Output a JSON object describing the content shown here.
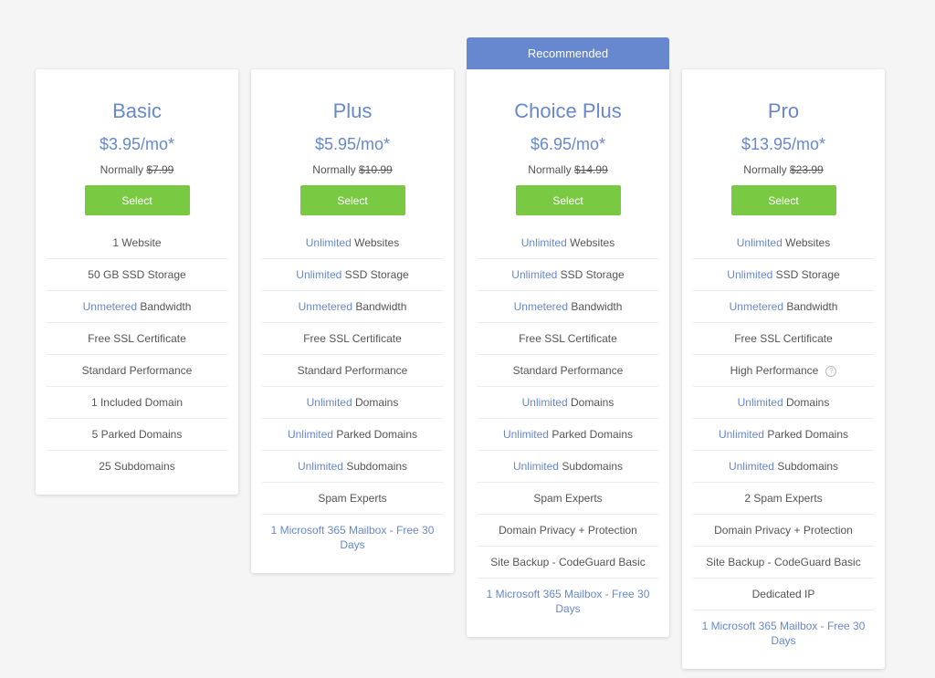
{
  "plans": [
    {
      "name": "Basic",
      "price": "$3.95/mo*",
      "normally_label": "Normally",
      "normal_price": "$7.99",
      "select_label": "Select",
      "features": [
        {
          "hl": "",
          "text": "1 Website"
        },
        {
          "hl": "",
          "text": "50 GB SSD Storage"
        },
        {
          "hl": "Unmetered",
          "text": " Bandwidth"
        },
        {
          "hl": "",
          "text": "Free SSL Certificate"
        },
        {
          "hl": "",
          "text": "Standard Performance"
        },
        {
          "hl": "",
          "text": "1 Included Domain"
        },
        {
          "hl": "",
          "text": "5 Parked Domains"
        },
        {
          "hl": "",
          "text": "25 Subdomains"
        }
      ]
    },
    {
      "name": "Plus",
      "price": "$5.95/mo*",
      "normally_label": "Normally",
      "normal_price": "$10.99",
      "select_label": "Select",
      "features": [
        {
          "hl": "Unlimited",
          "text": " Websites"
        },
        {
          "hl": "Unlimited",
          "text": " SSD Storage"
        },
        {
          "hl": "Unmetered",
          "text": " Bandwidth"
        },
        {
          "hl": "",
          "text": "Free SSL Certificate"
        },
        {
          "hl": "",
          "text": "Standard Performance"
        },
        {
          "hl": "Unlimited",
          "text": " Domains"
        },
        {
          "hl": "Unlimited",
          "text": " Parked Domains"
        },
        {
          "hl": "Unlimited",
          "text": " Subdomains"
        },
        {
          "hl": "",
          "text": "Spam Experts"
        },
        {
          "hl": "",
          "text": "",
          "link": "1 Microsoft 365 Mailbox - Free 30 Days"
        }
      ]
    },
    {
      "name": "Choice Plus",
      "banner": "Recommended",
      "price": "$6.95/mo*",
      "normally_label": "Normally",
      "normal_price": "$14.99",
      "select_label": "Select",
      "features": [
        {
          "hl": "Unlimited",
          "text": " Websites"
        },
        {
          "hl": "Unlimited",
          "text": " SSD Storage"
        },
        {
          "hl": "Unmetered",
          "text": " Bandwidth"
        },
        {
          "hl": "",
          "text": "Free SSL Certificate"
        },
        {
          "hl": "",
          "text": "Standard Performance"
        },
        {
          "hl": "Unlimited",
          "text": " Domains"
        },
        {
          "hl": "Unlimited",
          "text": " Parked Domains"
        },
        {
          "hl": "Unlimited",
          "text": " Subdomains"
        },
        {
          "hl": "",
          "text": "Spam Experts"
        },
        {
          "hl": "",
          "text": "Domain Privacy + Protection"
        },
        {
          "hl": "",
          "text": "Site Backup - CodeGuard Basic"
        },
        {
          "hl": "",
          "text": "",
          "link": "1 Microsoft 365 Mailbox - Free 30 Days"
        }
      ]
    },
    {
      "name": "Pro",
      "price": "$13.95/mo*",
      "normally_label": "Normally",
      "normal_price": "$23.99",
      "select_label": "Select",
      "features": [
        {
          "hl": "Unlimited",
          "text": " Websites"
        },
        {
          "hl": "Unlimited",
          "text": " SSD Storage"
        },
        {
          "hl": "Unmetered",
          "text": " Bandwidth"
        },
        {
          "hl": "",
          "text": "Free SSL Certificate"
        },
        {
          "hl": "",
          "text": "High Performance",
          "help": "?"
        },
        {
          "hl": "Unlimited",
          "text": " Domains"
        },
        {
          "hl": "Unlimited",
          "text": " Parked Domains"
        },
        {
          "hl": "Unlimited",
          "text": " Subdomains"
        },
        {
          "hl": "",
          "text": "2 Spam Experts"
        },
        {
          "hl": "",
          "text": "Domain Privacy + Protection"
        },
        {
          "hl": "",
          "text": "Site Backup - CodeGuard Basic"
        },
        {
          "hl": "",
          "text": "Dedicated IP"
        },
        {
          "hl": "",
          "text": "",
          "link": "1 Microsoft 365 Mailbox - Free 30 Days"
        }
      ]
    }
  ]
}
